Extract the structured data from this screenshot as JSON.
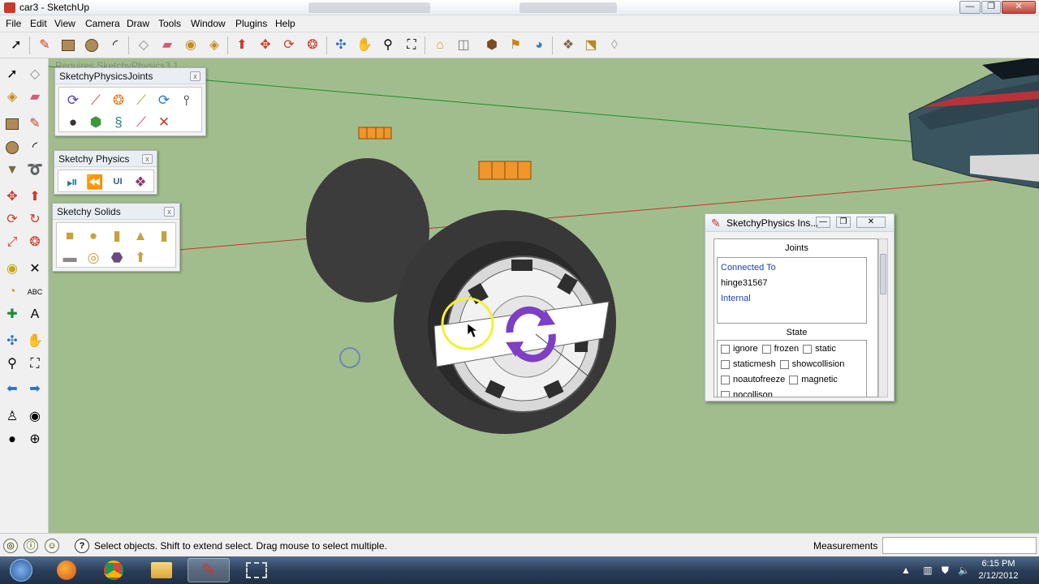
{
  "window": {
    "title": "car3 - SketchUp",
    "controls": {
      "minimize": "—",
      "maximize": "❐",
      "close": "✕"
    }
  },
  "menubar": {
    "items": [
      "File",
      "Edit",
      "View",
      "Camera",
      "Draw",
      "Tools",
      "Window",
      "Plugins",
      "Help"
    ]
  },
  "toolbar_top": {
    "icons": [
      "select-icon",
      "line-icon",
      "rectangle-icon",
      "circle-icon",
      "arc-icon",
      "make-component-icon",
      "eraser-icon",
      "tape-measure-icon",
      "paint-bucket-icon",
      "push-pull-icon",
      "move-icon",
      "rotate-icon",
      "offset-icon",
      "orbit-icon",
      "pan-icon",
      "zoom-icon",
      "zoom-extents-icon",
      "warehouse-icon",
      "share-model-icon",
      "get-components-icon",
      "place-model-icon",
      "google-earth-icon",
      "layers-icon",
      "section-icon",
      "style-icon"
    ]
  },
  "toolbar_left": {
    "icons": [
      "select-icon",
      "component-icon",
      "paint-icon",
      "eraser-icon",
      "rectangle-icon",
      "line-icon",
      "circle-icon",
      "arc-icon",
      "polygon-icon",
      "freehand-icon",
      "move-icon",
      "push-pull-icon",
      "rotate-icon",
      "follow-me-icon",
      "scale-icon",
      "offset-icon",
      "tape-icon",
      "dimension-icon",
      "protractor-icon",
      "text-icon",
      "axes-icon",
      "3d-text-icon",
      "orbit-icon",
      "pan-icon",
      "zoom-icon",
      "zoom-window-icon",
      "previous-icon",
      "next-icon",
      "position-camera-icon",
      "look-around-icon",
      "walk-icon",
      "section-plane-icon"
    ]
  },
  "viewport": {
    "overlay_text": "Requires SketchyPhysics3.1",
    "background": "#a2bd8d"
  },
  "palettes": {
    "joints": {
      "title": "SketchyPhysicsJoints",
      "close": "x"
    },
    "physics": {
      "title": "Sketchy Physics",
      "close": "x"
    },
    "solids": {
      "title": "Sketchy Solids",
      "close": "x"
    }
  },
  "inspector": {
    "title": "SketchyPhysics Ins...",
    "joints_header": "Joints",
    "connected_to_label": "Connected To",
    "connected_value": "hinge31567",
    "internal_label": "Internal",
    "state_header": "State",
    "checkboxes": [
      [
        "ignore",
        "frozen",
        "static"
      ],
      [
        "staticmesh",
        "showcollision"
      ],
      [
        "noautofreeze",
        "magnetic"
      ],
      [
        "nocollison"
      ]
    ]
  },
  "statusbar": {
    "hint": "Select objects. Shift to extend select. Drag mouse to select multiple.",
    "measurements_label": "Measurements",
    "measurements_value": ""
  },
  "taskbar": {
    "time": "6:15 PM",
    "date": "2/12/2012"
  },
  "colors": {
    "viewport_green": "#a2bd8d",
    "tire": "#3a3a3a",
    "accent_purple": "#7d3fc4",
    "link_blue": "#1d3fb3"
  }
}
